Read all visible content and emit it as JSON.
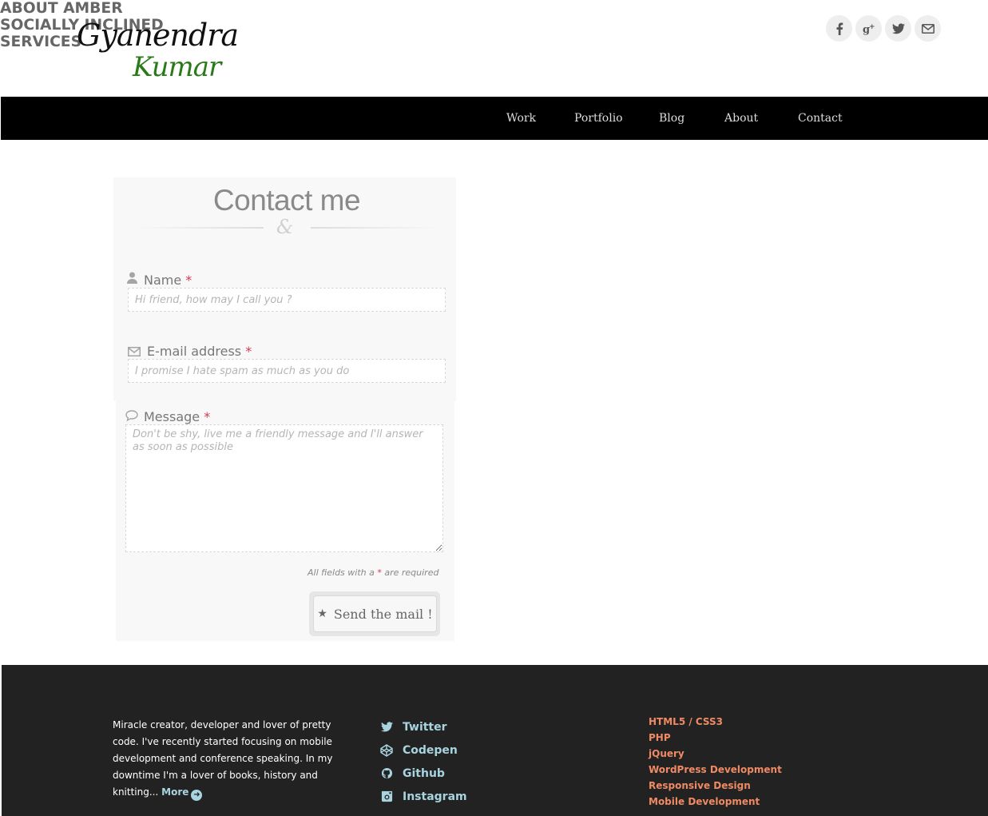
{
  "logo": {
    "line1": "Gyanendra",
    "line2": "Kumar"
  },
  "social_top": [
    {
      "icon": "facebook-icon",
      "glyph": "f"
    },
    {
      "icon": "google-plus-icon",
      "glyph": "g+"
    },
    {
      "icon": "twitter-icon",
      "glyph": "t"
    },
    {
      "icon": "mail-icon",
      "glyph": "✉"
    }
  ],
  "nav": {
    "work": "Work",
    "portfolio": "Portfolio",
    "blog": "Blog",
    "about": "About",
    "contact": "Contact"
  },
  "form": {
    "title": "Contact me",
    "ampersand": "&",
    "name_label": "Name",
    "name_placeholder": "Hi friend, how may I call you ?",
    "email_label": "E-mail address",
    "email_placeholder": "I promise I hate spam as much as you do",
    "message_label": "Message",
    "message_placeholder": "Don't be shy, live me a friendly message and I'll answer as soon as possible",
    "required_mark": "*",
    "required_note_before": "All fields with a",
    "required_note_after": "are required",
    "send_label": "Send the mail !"
  },
  "footer": {
    "about_title": "ABOUT AMBER",
    "about_text": "Miracle creator, developer and lover of pretty code. I've recently started focusing on mobile development and conference speaking. In my downtime I'm a lover of books, history and knitting...",
    "more_label": "More",
    "social_title": "SOCIALLY INCLINED",
    "social": {
      "twitter": "Twitter",
      "codepen": "Codepen",
      "github": "Github",
      "instagram": "Instagram"
    },
    "services_title": "SERVICES",
    "services": [
      "HTML5 / CSS3",
      "PHP",
      "jQuery",
      "WordPress Development",
      "Responsive Design",
      "Mobile Development"
    ]
  },
  "colors": {
    "nav_bg": "#000000",
    "footer_bg": "#222222",
    "logo_accent": "#2b7a1a",
    "required": "#d33a4c",
    "link_blue": "#a8d4e0",
    "service_orange": "#f08a64"
  }
}
